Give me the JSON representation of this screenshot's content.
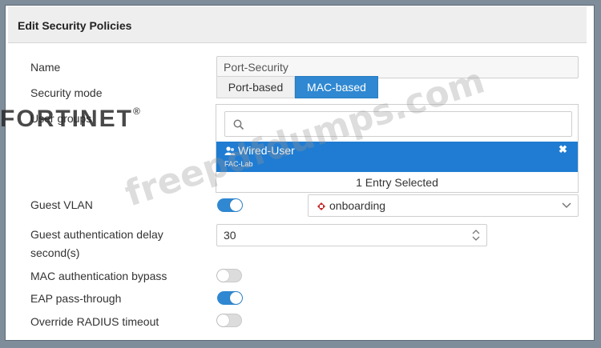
{
  "panel": {
    "title": "Edit Security Policies"
  },
  "form": {
    "name": {
      "label": "Name",
      "value": "Port-Security"
    },
    "security_mode": {
      "label": "Security mode",
      "options": [
        "Port-based",
        "MAC-based"
      ],
      "selected": "MAC-based"
    },
    "user_groups": {
      "label": "User groups",
      "selected_item": {
        "name": "Wired-User",
        "sub": "FAC-Lab",
        "remove_glyph": "✖"
      },
      "count_text": "1 Entry Selected"
    },
    "guest_vlan": {
      "label": "Guest VLAN",
      "enabled": true,
      "value": "onboarding"
    },
    "guest_auth_delay": {
      "label_line1": "Guest authentication delay",
      "label_line2": "second(s)",
      "value": "30"
    },
    "mac_auth_bypass": {
      "label": "MAC authentication bypass",
      "enabled": false
    },
    "eap_pass_through": {
      "label": "EAP pass-through",
      "enabled": true
    },
    "override_radius_timeout": {
      "label": "Override RADIUS timeout",
      "enabled": false
    }
  },
  "overlay": {
    "logo": "FORTINET",
    "logo_mark": "®",
    "watermark": "freepdfdumps.com"
  },
  "colors": {
    "accent": "#2f88d1",
    "selected_row": "#1f7cd2",
    "frame": "#7f8c99"
  }
}
